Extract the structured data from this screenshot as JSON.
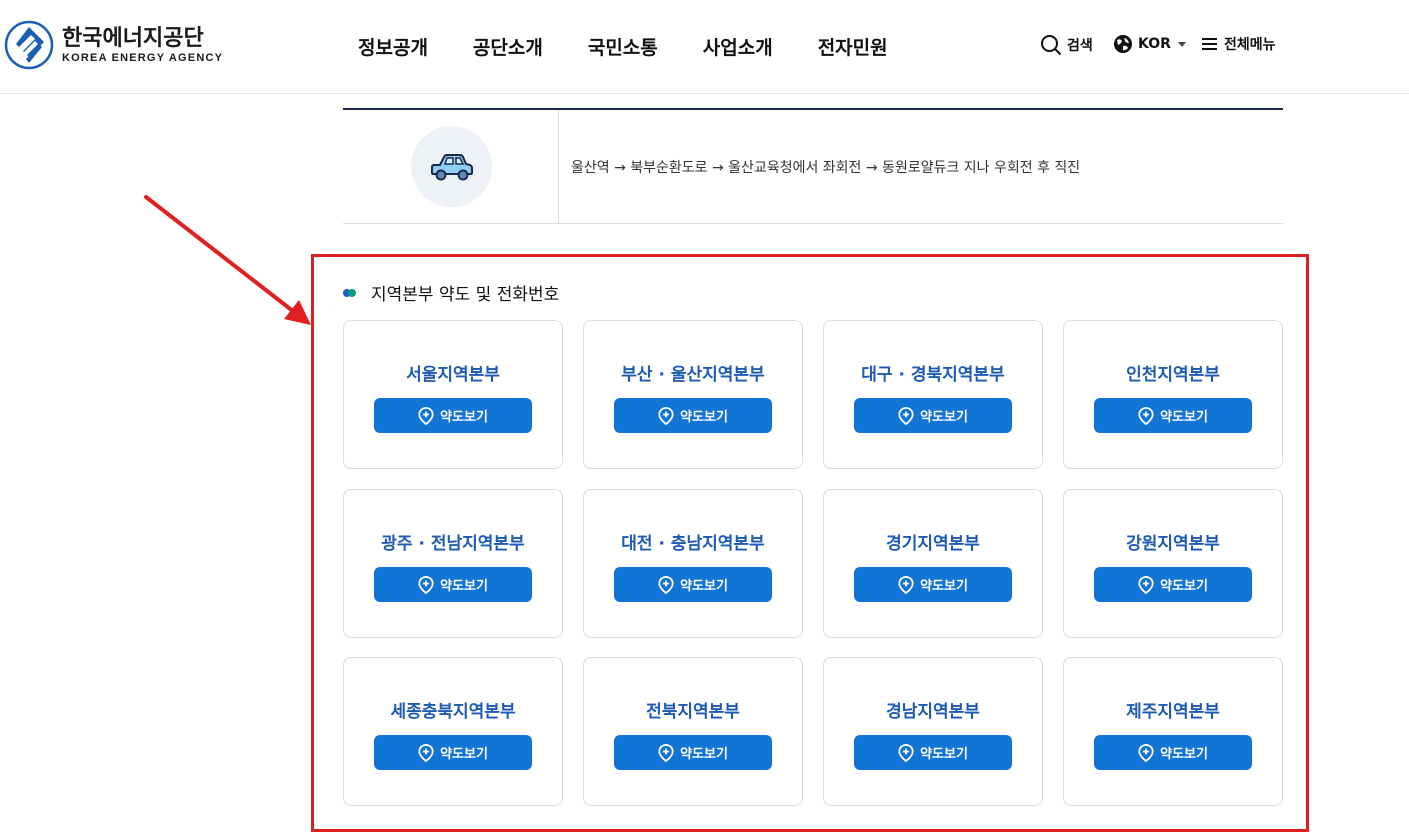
{
  "header": {
    "logo_ko": "한국에너지공단",
    "logo_en": "KOREA ENERGY AGENCY",
    "nav": [
      "정보공개",
      "공단소개",
      "국민소통",
      "사업소개",
      "전자민원"
    ],
    "search_label": "검색",
    "lang_label": "KOR",
    "menu_label": "전체메뉴"
  },
  "directions": {
    "icon": "car-icon",
    "text": "울산역 → 북부순환도로 → 울산교육청에서 좌회전 → 동원로얄듀크 지나 우회전 후 직진"
  },
  "section": {
    "title": "지역본부 약도 및 전화번호"
  },
  "button_label": "약도보기",
  "offices": [
    "서울지역본부",
    "부산 · 울산지역본부",
    "대구 · 경북지역본부",
    "인천지역본부",
    "광주 · 전남지역본부",
    "대전 · 충남지역본부",
    "경기지역본부",
    "강원지역본부",
    "세종충북지역본부",
    "전북지역본부",
    "경남지역본부",
    "제주지역본부"
  ],
  "colors": {
    "brand_blue": "#1274d5",
    "office_title": "#1d5ab2",
    "annotation_red": "#e02020"
  }
}
